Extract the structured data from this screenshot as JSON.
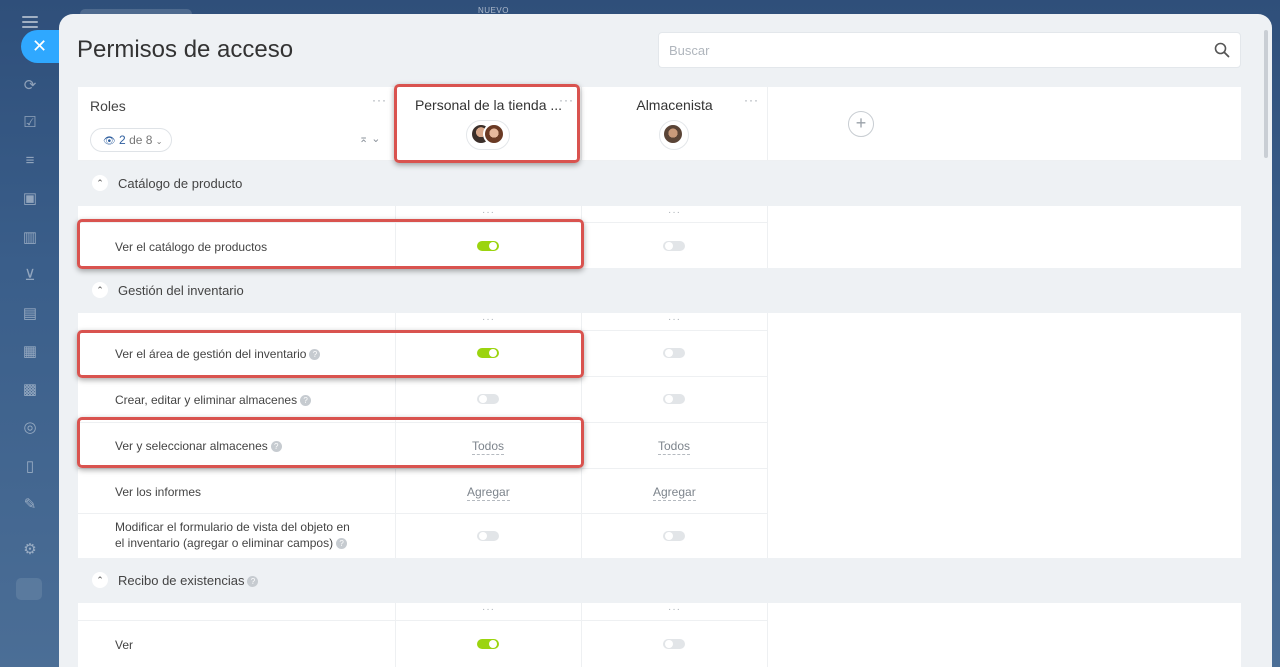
{
  "topbar": {
    "new_label": "NUEVO"
  },
  "panel": {
    "title": "Permisos de acceso",
    "search_placeholder": "Buscar"
  },
  "header": {
    "roles_label": "Roles",
    "counter_value": "2",
    "counter_suffix": "de 8",
    "columns": [
      {
        "name": "Personal de la tienda ..."
      },
      {
        "name": "Almacenista"
      }
    ],
    "add_column": "+"
  },
  "sections": [
    {
      "title": "Catálogo de producto"
    },
    {
      "title": "Gestión del inventario"
    },
    {
      "title": "Recibo de existencias"
    }
  ],
  "rows": [
    {
      "label": "Ver el catálogo de productos",
      "c1": "on",
      "c2": "off"
    },
    {
      "label": "Ver el área de gestión del inventario",
      "c1": "on",
      "c2": "off"
    },
    {
      "label": "Crear, editar y eliminar almacenes",
      "c1": "off",
      "c2": "off"
    },
    {
      "label": "Ver y seleccionar almacenes",
      "c1": "Todos",
      "c2": "Todos"
    },
    {
      "label": "Ver los informes",
      "c1": "Agregar",
      "c2": "Agregar"
    },
    {
      "label_line1": "Modificar el formulario de vista del objeto en",
      "label_line2": "el inventario (agregar o eliminar campos)",
      "c1": "off",
      "c2": "off"
    },
    {
      "label": "Ver",
      "c1": "on",
      "c2": "off"
    }
  ],
  "colors": {
    "accent": "#2fa8ff",
    "toggle_on": "#9bd40f",
    "highlight": "#d9534f"
  }
}
